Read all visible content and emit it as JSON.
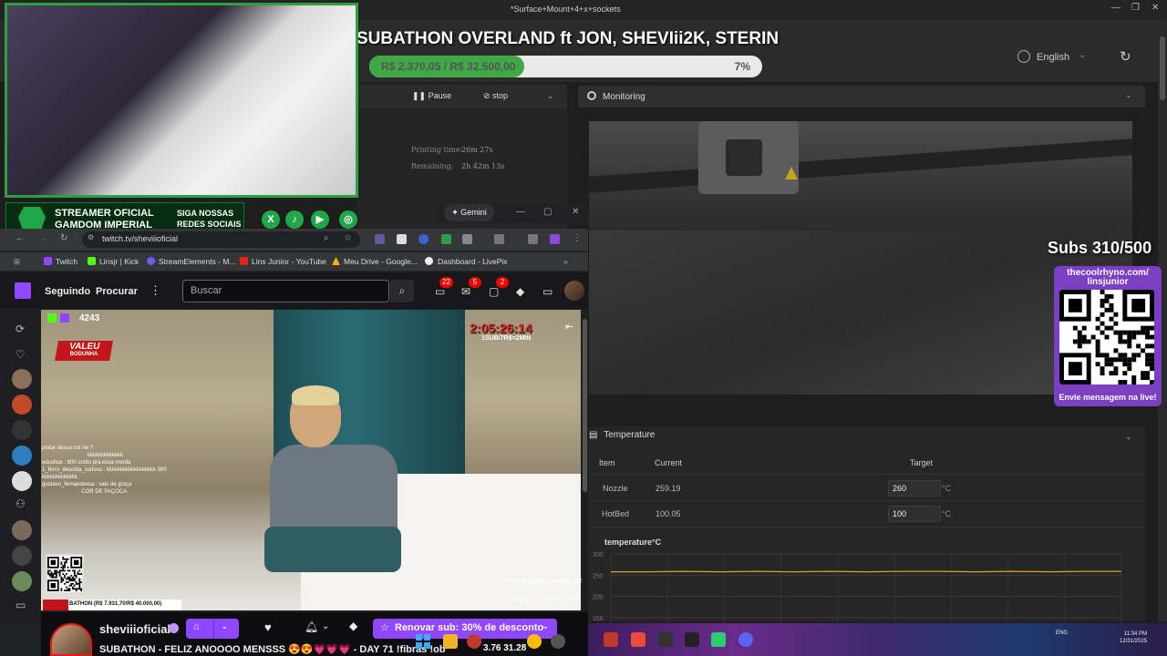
{
  "app": {
    "title": "*Surface+Mount+4+x+sockets",
    "language": "English",
    "pause_label": "Pause",
    "stop_label": "stop",
    "printing_time_label": "Printing time:",
    "printing_time_value": "26m 27s",
    "remaining_label": "Remaining:",
    "remaining_value": "2h 42m 13s",
    "monitoring_label": "Monitoring",
    "temperature_label": "Temperature",
    "temp_columns": [
      "Item",
      "Current",
      "Target"
    ],
    "temp_rows": [
      {
        "item": "Nozzle",
        "current": "259.19",
        "target": "260",
        "unit": "°C"
      },
      {
        "item": "HotBed",
        "current": "100.05",
        "target": "100",
        "unit": "°C"
      }
    ],
    "chart_title": "temperature°C"
  },
  "chart_data": {
    "type": "line",
    "title": "temperature°C",
    "y_ticks": [
      "300",
      "250",
      "200",
      "150"
    ],
    "ylim": [
      150,
      300
    ],
    "series": [
      {
        "values": [
          258,
          258,
          259,
          258,
          259,
          258,
          259,
          258,
          259,
          259,
          258,
          259,
          258,
          259,
          259
        ]
      }
    ],
    "grid": true,
    "color": "#e0a020"
  },
  "overlay": {
    "title": "SUBATHON OVERLAND ft JON, SHEVIii2K, STERIN",
    "progress_amount": "R$ 2.370,05 / R$ 32.500,00",
    "progress_pct": "7%",
    "progress_fraction": 0.07,
    "subs_goal": "Subs 310/500",
    "qr_url": "thecoolrhyno.com/ linsjunior",
    "qr_caption": "Envie mensagem na live!",
    "banner_line1": "STREAMER OFICIAL",
    "banner_line2": "GAMDOM IMPERIAL",
    "banner_right1": "SIGA NOSSAS",
    "banner_right2": "REDES SOCIAIS"
  },
  "browser": {
    "gemini_label": "Gemini",
    "url": "twitch.tv/sheviiioficial",
    "bookmarks": [
      "Twitch",
      "Linsjr | Kick",
      "StreamElements - M...",
      "Lins Junior - YouTube",
      "Meu Drive - Google...",
      "Dashboard - LivePix"
    ]
  },
  "twitch": {
    "nav_following": "Seguindo",
    "nav_browse": "Procurar",
    "search_placeholder": "Buscar",
    "badges": [
      "22",
      "5",
      "2"
    ],
    "kick_viewers": "4243",
    "valeu_label": "VALEU",
    "valeu_sub": "BODUNHA",
    "timer": "2:05:26:14",
    "timer_sub": "1SUB/7R$=2MIN",
    "chat_lines": [
      "pintar dessa cor ne ?",
      "kkkkkkkkkkkkk",
      "edushox : 600 conto pra essa merda",
      "1_ferro_desolda_curioso : kkkkkkkkkkkkkkkkkk 500 kkkkkkkkkkkkk",
      "gustavo_fernandessa : saiu de graça",
      ": COR DE PAÇOCA"
    ],
    "sub_bar_text": "BATHON (R$ 7.931,70/R$ 40.000,00)",
    "location": "PLATTE RIDGE, KANSAS CITY",
    "hud": "0 KM/H  12°C  10:39:00 PM",
    "channel_name": "sheviiioficial",
    "channel_title": "SUBATHON - FELIZ ANOOOO MENSSS 😍😍💗💗💗 - DAY 71 !fibras !ob",
    "renew_label": "Renovar sub: 30% de desconto"
  },
  "taskbar": {
    "tray_text": "ENG",
    "clock": "11:34 PM",
    "date": "12/31/2025",
    "overlay_text": "3.76  31.28"
  }
}
